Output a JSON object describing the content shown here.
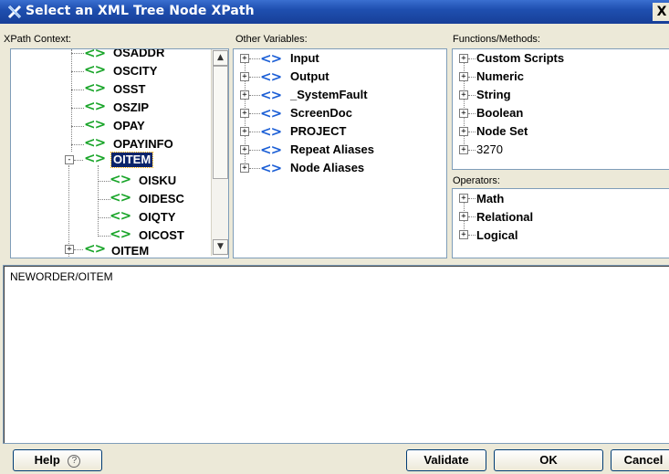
{
  "window": {
    "title": "Select an XML Tree Node XPath",
    "close_label": "X"
  },
  "labels": {
    "xpath_context": "XPath Context:",
    "other_variables": "Other Variables:",
    "functions_methods": "Functions/Methods:",
    "operators": "Operators:"
  },
  "xpath_tree": [
    {
      "label": "OSADDR",
      "expandable": false
    },
    {
      "label": "OSCITY",
      "expandable": false
    },
    {
      "label": "OSST",
      "expandable": false
    },
    {
      "label": "OSZIP",
      "expandable": false
    },
    {
      "label": "OPAY",
      "expandable": false
    },
    {
      "label": "OPAYINFO",
      "expandable": false
    },
    {
      "label": "OITEM",
      "expandable": true,
      "expanded": true,
      "selected": true
    },
    {
      "label": "OISKU",
      "expandable": false
    },
    {
      "label": "OIDESC",
      "expandable": false
    },
    {
      "label": "OIQTY",
      "expandable": false
    },
    {
      "label": "OICOST",
      "expandable": false
    },
    {
      "label": "OITEM",
      "expandable": true,
      "expanded": false
    }
  ],
  "other_variables": [
    "Input",
    "Output",
    "_SystemFault",
    "ScreenDoc",
    "PROJECT",
    "Repeat Aliases",
    "Node Aliases"
  ],
  "functions": [
    "Custom Scripts",
    "Numeric",
    "String",
    "Boolean",
    "Node Set",
    "3270"
  ],
  "operators": [
    "Math",
    "Relational",
    "Logical"
  ],
  "xpath_expression": "NEWORDER/OITEM",
  "buttons": {
    "help": "Help",
    "validate": "Validate",
    "ok": "OK",
    "cancel": "Cancel"
  },
  "icons": {
    "xml_node": "<>",
    "help": "?",
    "expand": "+",
    "collapse": "-",
    "scroll_up": "▲",
    "scroll_down": "▼"
  },
  "colors": {
    "titlebar": "#1f4fb0",
    "xml_icon_green": "#1aa52a",
    "xml_icon_blue": "#1c5fd6",
    "selection": "#0a246a"
  }
}
